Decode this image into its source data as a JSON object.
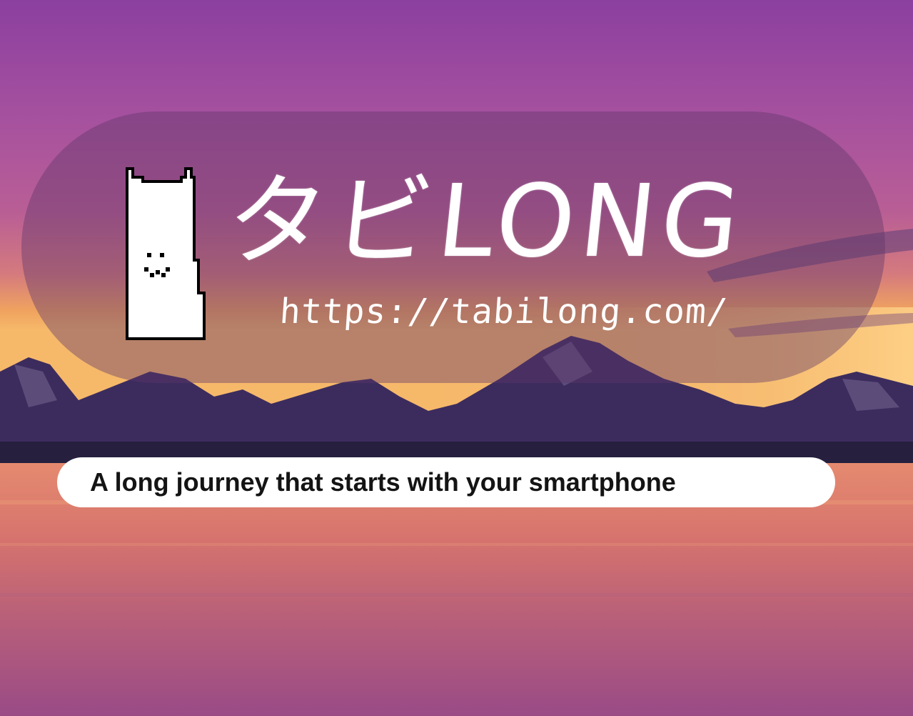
{
  "brand": {
    "name": "タビLONG",
    "url": "https://tabilong.com/"
  },
  "tagline": "A long journey that starts with your smartphone",
  "icons": {
    "mascot": "cat-mascot-icon"
  },
  "colors": {
    "sky_top": "#8a3f9e",
    "sky_mid": "#b7559a",
    "horizon": "#f2a85c",
    "mountains": "#3b2b5c",
    "water": "#d9726b",
    "text": "#ffffff",
    "tagline_text": "#141414"
  }
}
